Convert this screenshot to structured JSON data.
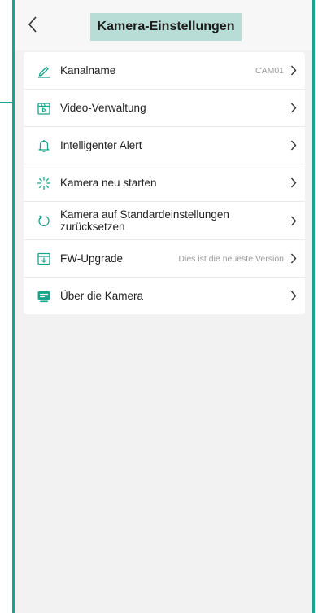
{
  "header": {
    "title": "Kamera-Einstellungen",
    "back_icon": "chevron-left-icon"
  },
  "colors": {
    "accent": "#17a58c",
    "title_highlight": "#b8ddd6",
    "icon": "#17a58c",
    "background": "#f2f2f2"
  },
  "settings": [
    {
      "label": "Kanalname",
      "value": "CAM01",
      "icon": "pencil-icon"
    },
    {
      "label": "Video-Verwaltung",
      "value": "",
      "icon": "video-calendar-icon"
    },
    {
      "label": "Intelligenter Alert",
      "value": "",
      "icon": "bell-icon"
    },
    {
      "label": "Kamera neu starten",
      "value": "",
      "icon": "loading-spinner-icon"
    },
    {
      "label": "Kamera auf Standardeinstellungen zurücksetzen",
      "value": "",
      "icon": "reset-icon"
    },
    {
      "label": "FW-Upgrade",
      "value": "Dies ist die neueste Version",
      "icon": "download-icon"
    },
    {
      "label": "Über die Kamera",
      "value": "",
      "icon": "monitor-icon"
    }
  ]
}
